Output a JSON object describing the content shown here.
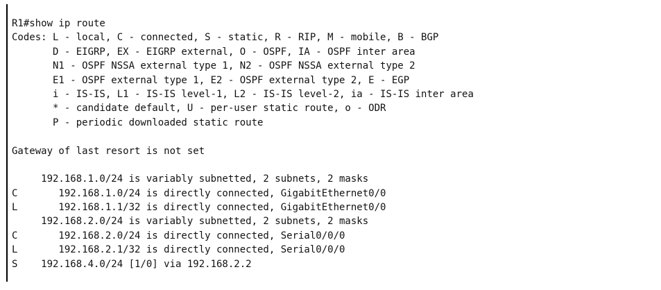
{
  "terminal": {
    "lines": [
      "R1#show ip route",
      "Codes: L - local, C - connected, S - static, R - RIP, M - mobile, B - BGP",
      "       D - EIGRP, EX - EIGRP external, O - OSPF, IA - OSPF inter area",
      "       N1 - OSPF NSSA external type 1, N2 - OSPF NSSA external type 2",
      "       E1 - OSPF external type 1, E2 - OSPF external type 2, E - EGP",
      "       i - IS-IS, L1 - IS-IS level-1, L2 - IS-IS level-2, ia - IS-IS inter area",
      "       * - candidate default, U - per-user static route, o - ODR",
      "       P - periodic downloaded static route",
      "",
      "Gateway of last resort is not set",
      "",
      "     192.168.1.0/24 is variably subnetted, 2 subnets, 2 masks",
      "C       192.168.1.0/24 is directly connected, GigabitEthernet0/0",
      "L       192.168.1.1/32 is directly connected, GigabitEthernet0/0",
      "     192.168.2.0/24 is variably subnetted, 2 subnets, 2 masks",
      "C       192.168.2.0/24 is directly connected, Serial0/0/0",
      "L       192.168.2.1/32 is directly connected, Serial0/0/0",
      "S    192.168.4.0/24 [1/0] via 192.168.2.2"
    ]
  }
}
